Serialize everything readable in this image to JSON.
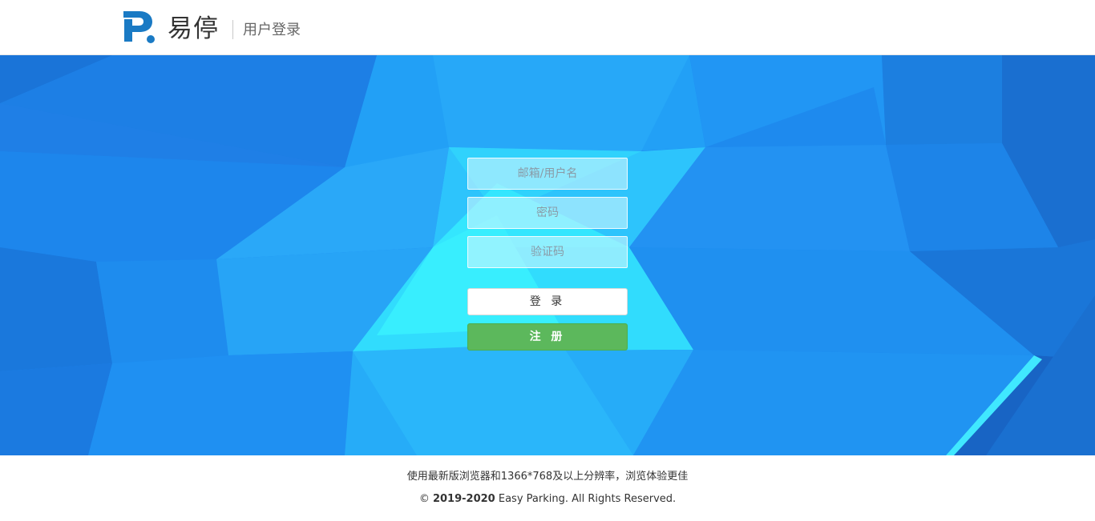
{
  "header": {
    "brand_name": "易停",
    "subtitle": "用户登录"
  },
  "login_form": {
    "email_placeholder": "邮箱/用户名",
    "password_placeholder": "密码",
    "captcha_placeholder": "验证码",
    "login_label": "登 录",
    "register_label": "注 册"
  },
  "footer": {
    "browser_note": "使用最新版浏览器和1366*768及以上分辨率，浏览体验更佳",
    "copyright_symbol": "©",
    "copyright_years": "2019-2020",
    "copyright_text": "Easy Parking. All Rights Reserved."
  },
  "colors": {
    "brand_blue": "#1a7ac4",
    "background_blue": "#1e88f0",
    "register_green": "#5cb85c"
  }
}
